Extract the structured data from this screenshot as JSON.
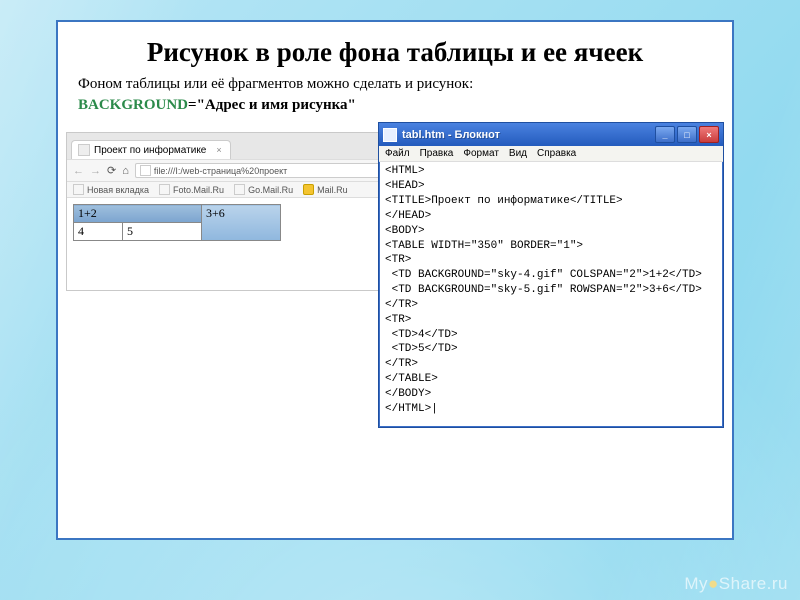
{
  "slide": {
    "title": "Рисунок в роле фона таблицы и ее ячеек",
    "description": "Фоном таблицы или её фрагментов можно сделать и рисунок:",
    "attr_name": "BACKGROUND",
    "attr_eq": "=",
    "attr_value": "\"Адрес и имя рисунка\""
  },
  "browser": {
    "tab_title": "Проект по информатике",
    "address": "file:///I:/web-страница%20проект",
    "bookmarks": [
      "Новая вкладка",
      "Foto.Mail.Ru",
      "Go.Mail.Ru",
      "Mail.Ru"
    ],
    "table": {
      "c12": "1+2",
      "c36": "3+6",
      "c4": "4",
      "c5": "5"
    }
  },
  "notepad": {
    "title": "tabl.htm - Блокнот",
    "menu": [
      "Файл",
      "Правка",
      "Формат",
      "Вид",
      "Справка"
    ],
    "code": "<HTML>\n<HEAD>\n<TITLE>Проект по информатике</TITLE>\n</HEAD>\n<BODY>\n<TABLE WIDTH=\"350\" BORDER=\"1\">\n<TR>\n <TD BACKGROUND=\"sky-4.gif\" COLSPAN=\"2\">1+2</TD>\n <TD BACKGROUND=\"sky-5.gif\" ROWSPAN=\"2\">3+6</TD>\n</TR>\n<TR>\n <TD>4</TD>\n <TD>5</TD>\n</TR>\n</TABLE>\n</BODY>\n</HTML>|"
  },
  "watermark": {
    "prefix": "My",
    "o": "●",
    "suffix": "Share.ru"
  }
}
